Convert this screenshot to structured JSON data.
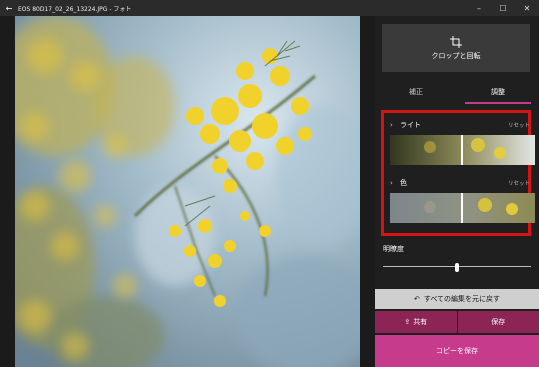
{
  "window": {
    "title": "EOS 80D17_02_26_13224.JPG - フォト",
    "back_icon": "back-arrow-icon",
    "minimize_icon": "minimize-icon",
    "maximize_icon": "maximize-icon",
    "close_icon": "close-icon"
  },
  "panel": {
    "crop_button_label": "クロップと回転",
    "tabs": [
      {
        "label": "補正",
        "active": false
      },
      {
        "label": "調整",
        "active": true
      }
    ],
    "adjustments": [
      {
        "label": "ライト",
        "reset": "リセット"
      },
      {
        "label": "色",
        "reset": "リセット"
      }
    ],
    "clarity_label": "明瞭度",
    "clarity_value": 0.5,
    "revert_label": "すべての編集を元に戻す",
    "share_label": "共有",
    "save_label": "保存",
    "save_copy_label": "コピーを保存"
  },
  "colors": {
    "accent": "#c63b8b",
    "accent_dark": "#8c2556",
    "highlight_border": "#d21414"
  }
}
